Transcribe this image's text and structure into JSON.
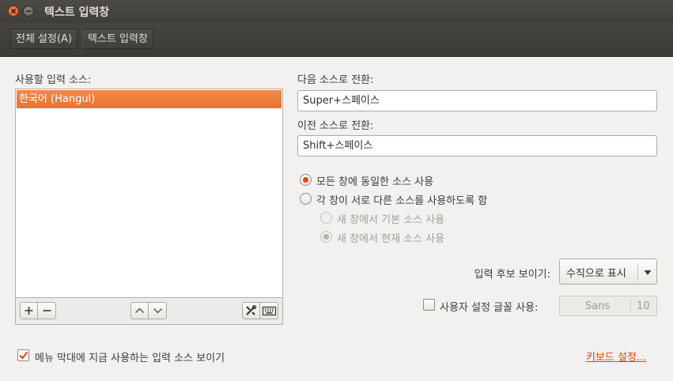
{
  "window": {
    "title": "텍스트 입력창"
  },
  "tabs": {
    "general": "전체 설정(A)",
    "input": "텍스트 입력창"
  },
  "sources": {
    "label": "사용할 입력 소스:",
    "items": [
      "한국어 (Hangul)"
    ]
  },
  "shortcuts": {
    "next_label": "다음 소스로 전환:",
    "next_value": "Super+스페이스",
    "prev_label": "이전 소스로 전환:",
    "prev_value": "Shift+스페이스"
  },
  "mode": {
    "same_all": "모든 창에 동일한 소스 사용",
    "per_window": "각 창이 서로 다른 소스를 사용하도록 함",
    "new_default": "새 창에서 기본 소스 사용",
    "new_current": "새 창에서 현재 소스 사용"
  },
  "candidates": {
    "label": "입력 후보 보이기:",
    "value": "수직으로 표시"
  },
  "custom_font": {
    "label": "사용자 설정 글꼴 사용:",
    "font": "Sans",
    "size": "10"
  },
  "menu_show": {
    "label": "메뉴 막대에 지금 사용하는 입력 소스 보이기"
  },
  "keyboard_link": "키보드 설정...",
  "colors": {
    "accent": "#dd4814",
    "selection": "#f07746",
    "titlebar": "#3c3b37"
  },
  "icons": [
    "close-icon",
    "minimize-icon",
    "plus-icon",
    "minus-icon",
    "arrow-up-icon",
    "arrow-down-icon",
    "settings-tools-icon",
    "keyboard-icon",
    "chevron-down-icon",
    "checkmark-icon"
  ]
}
